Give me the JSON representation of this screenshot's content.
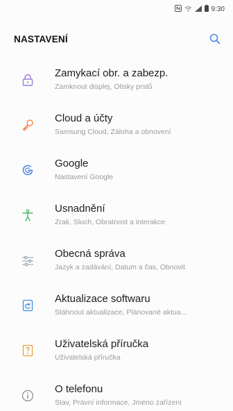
{
  "status_bar": {
    "icons": [
      "nfc-icon",
      "wifi-icon",
      "signal-icon",
      "battery-icon"
    ],
    "time": "9:30"
  },
  "header": {
    "title": "NASTAVENÍ",
    "search_icon": "search-icon",
    "accent_color": "#4a8fe0"
  },
  "items": [
    {
      "icon": "lock-icon",
      "color": "#9b7ae0",
      "label": "Zamykací obr. a zabezp.",
      "sub": "Zamknout displej, Otisky prstů"
    },
    {
      "icon": "key-icon",
      "color": "#f28a4a",
      "label": "Cloud a účty",
      "sub": "Samsung Cloud, Záloha a obnovení"
    },
    {
      "icon": "google-icon",
      "color": "#4a7fe8",
      "label": "Google",
      "sub": "Nastavení Google"
    },
    {
      "icon": "accessibility-icon",
      "color": "#4cb86a",
      "label": "Usnadnění",
      "sub": "Zrak, Sluch, Obratnost a interakce"
    },
    {
      "icon": "sliders-icon",
      "color": "#8a9aaa",
      "label": "Obecná správa",
      "sub": "Jazyk a zadávání, Datum a čas, Obnovit"
    },
    {
      "icon": "update-icon",
      "color": "#3a8ee6",
      "label": "Aktualizace softwaru",
      "sub": "Stáhnout aktualizace, Plánované aktua..."
    },
    {
      "icon": "manual-icon",
      "color": "#e8a23a",
      "label": "Uživatelská příručka",
      "sub": "Uživatelská příručka"
    },
    {
      "icon": "info-icon",
      "color": "#8a8a8a",
      "label": "O telefonu",
      "sub": "Stav, Právní informace, Jméno zařízení"
    }
  ]
}
